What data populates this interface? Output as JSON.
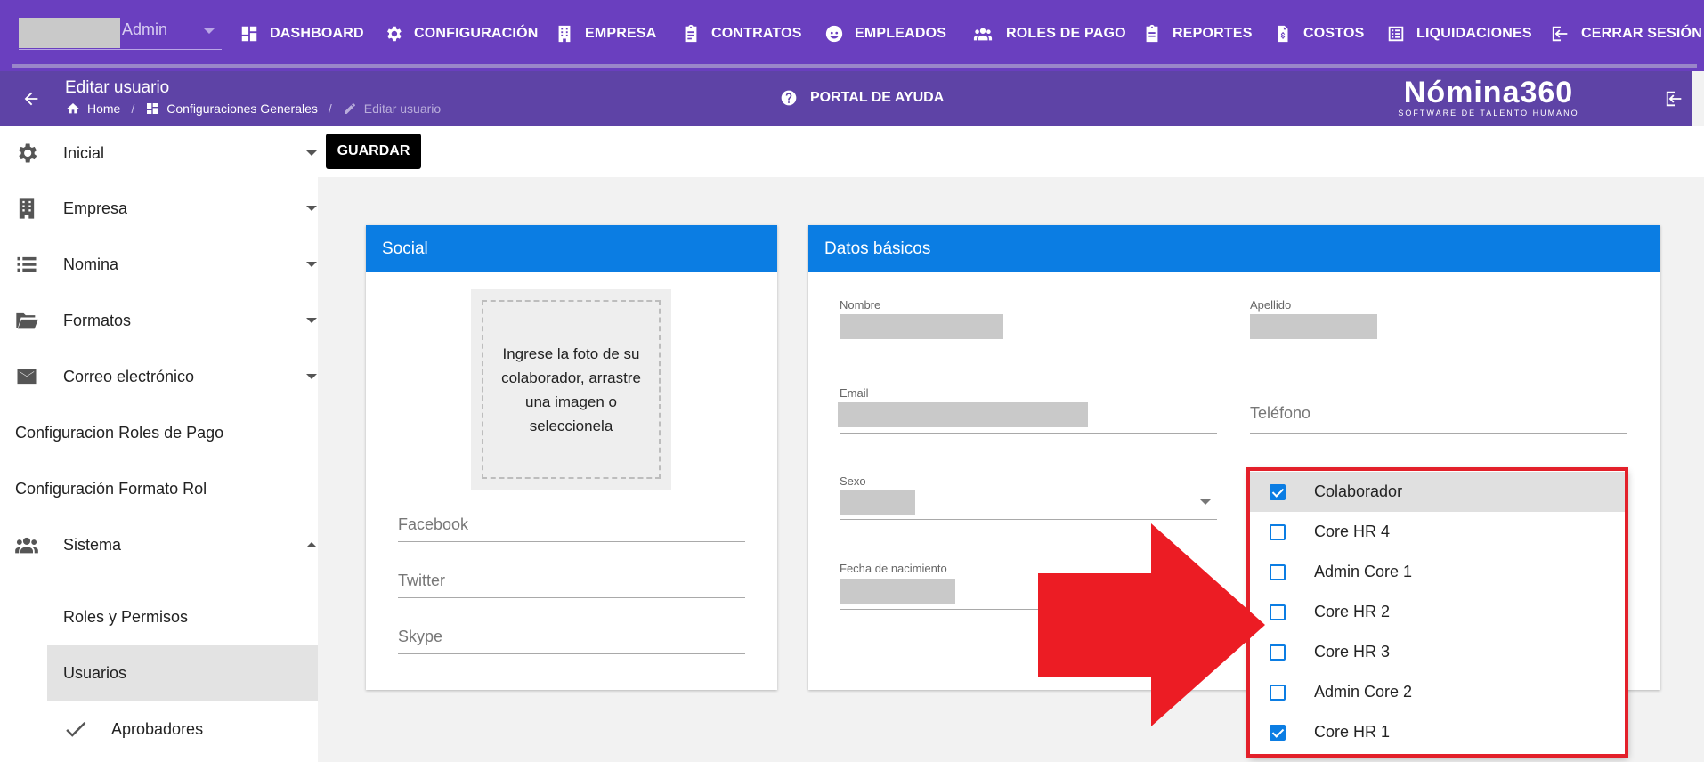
{
  "topnav": {
    "user_role": "Admin",
    "items": [
      {
        "label": "DASHBOARD",
        "icon": "dashboard-icon"
      },
      {
        "label": "CONFIGURACIÓN",
        "icon": "gear-icon"
      },
      {
        "label": "EMPRESA",
        "icon": "building-icon"
      },
      {
        "label": "CONTRATOS",
        "icon": "clipboard-icon"
      },
      {
        "label": "EMPLEADOS",
        "icon": "face-icon"
      },
      {
        "label": "ROLES DE PAGO",
        "icon": "people-icon"
      },
      {
        "label": "REPORTES",
        "icon": "report-icon"
      },
      {
        "label": "COSTOS",
        "icon": "invoice-icon"
      },
      {
        "label": "LIQUIDACIONES",
        "icon": "list-icon"
      },
      {
        "label": "CERRAR SESIÓN",
        "icon": "logout-icon"
      }
    ]
  },
  "subbar": {
    "title": "Editar usuario",
    "breadcrumb": {
      "home": "Home",
      "section": "Configuraciones Generales",
      "current": "Editar usuario"
    },
    "help": "PORTAL DE AYUDA",
    "logo_main": "Nómina360",
    "logo_sub": "SOFTWARE DE TALENTO HUMANO"
  },
  "sidebar": {
    "items": [
      {
        "label": "Inicial",
        "icon": "gear-icon"
      },
      {
        "label": "Empresa",
        "icon": "building-icon"
      },
      {
        "label": "Nomina",
        "icon": "list-icon"
      },
      {
        "label": "Formatos",
        "icon": "folder-icon"
      },
      {
        "label": "Correo electrónico",
        "icon": "mail-icon"
      },
      {
        "label": "Configuracion Roles de Pago"
      },
      {
        "label": "Configuración Formato Rol"
      },
      {
        "label": "Sistema",
        "icon": "people-icon"
      }
    ],
    "sub_items": {
      "roles": "Roles y Permisos",
      "usuarios": "Usuarios",
      "aprobadores": "Aprobadores"
    }
  },
  "toolbar": {
    "save_label": "GUARDAR"
  },
  "social": {
    "title": "Social",
    "photo_hint": "Ingrese la foto de su colaborador, arrastre una imagen o seleccionela",
    "facebook": "Facebook",
    "twitter": "Twitter",
    "skype": "Skype"
  },
  "datos": {
    "title": "Datos básicos",
    "nombre": "Nombre",
    "apellido": "Apellido",
    "email": "Email",
    "telefono": "Teléfono",
    "sexo": "Sexo",
    "fecha": "Fecha de nacimiento"
  },
  "roles": [
    {
      "label": "Colaborador",
      "checked": true
    },
    {
      "label": "Core HR 4",
      "checked": false
    },
    {
      "label": "Admin Core 1",
      "checked": false
    },
    {
      "label": "Core HR 2",
      "checked": false
    },
    {
      "label": "Core HR 3",
      "checked": false
    },
    {
      "label": "Admin Core 2",
      "checked": false
    },
    {
      "label": "Core HR 1",
      "checked": true
    }
  ],
  "colors": {
    "primary": "#6a3fbf",
    "subbar": "#5e43a6",
    "card_header": "#0b7de3",
    "highlight": "#e3202a"
  }
}
